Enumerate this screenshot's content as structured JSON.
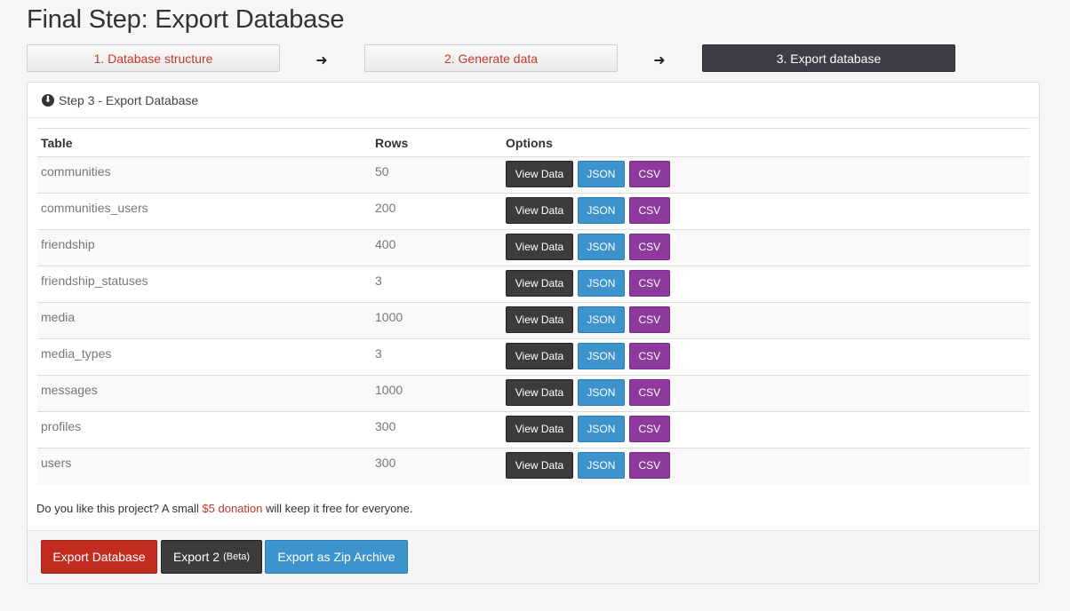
{
  "page": {
    "title": "Final Step: Export Database"
  },
  "steps": [
    {
      "label": "1. Database structure"
    },
    {
      "label": "2. Generate data"
    },
    {
      "label": "3. Export database"
    }
  ],
  "icons": {
    "step_arrow": "right-arrow-icon",
    "heading_icon": "download-circle-icon"
  },
  "panel": {
    "heading": "Step 3 - Export Database"
  },
  "table": {
    "headers": {
      "table": "Table",
      "rows": "Rows",
      "options": "Options"
    },
    "rows": [
      {
        "name": "communities",
        "rows": "50"
      },
      {
        "name": "communities_users",
        "rows": "200"
      },
      {
        "name": "friendship",
        "rows": "400"
      },
      {
        "name": "friendship_statuses",
        "rows": "3"
      },
      {
        "name": "media",
        "rows": "1000"
      },
      {
        "name": "media_types",
        "rows": "3"
      },
      {
        "name": "messages",
        "rows": "1000"
      },
      {
        "name": "profiles",
        "rows": "300"
      },
      {
        "name": "users",
        "rows": "300"
      }
    ],
    "buttons": {
      "view": "View Data",
      "json": "JSON",
      "csv": "CSV"
    }
  },
  "donation": {
    "before": "Do you like this project? A small ",
    "link": "$5 donation",
    "after": " will keep it free for everyone."
  },
  "footer": {
    "export_label": "Export Database",
    "export2_label": "Export 2",
    "export2_badge": "(Beta)",
    "zip_label": "Export as Zip Archive"
  },
  "colors": {
    "accent_red": "#c12b20",
    "link_red": "#c0392b",
    "json_blue": "#3d94cc",
    "csv_purple": "#8e3a9c",
    "dark": "#3c3c3c"
  }
}
